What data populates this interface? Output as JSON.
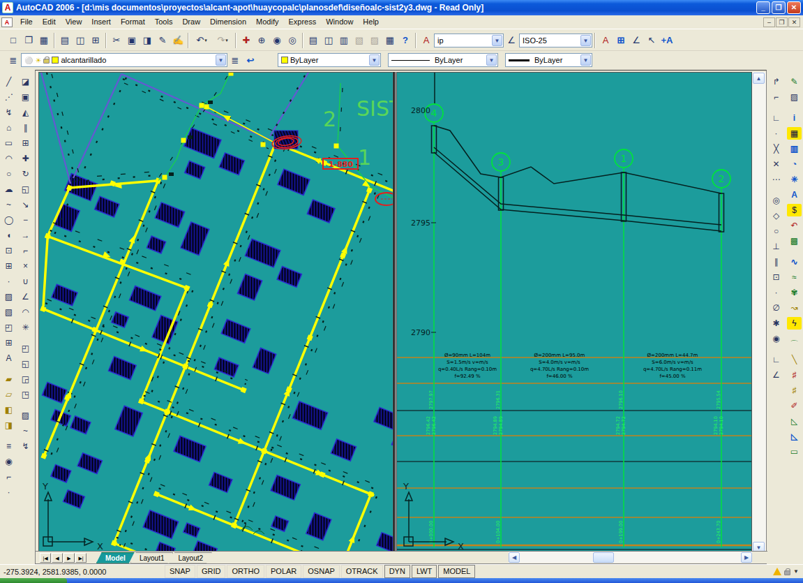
{
  "window": {
    "title": "AutoCAD 2006 - [d:\\mis documentos\\proyectos\\alcant-apot\\huaycopalc\\planosdef\\diseñoalc-sist2y3.dwg - Read Only]",
    "minimize": "_",
    "restore": "❐",
    "close": "✕"
  },
  "menu": {
    "items": [
      "File",
      "Edit",
      "View",
      "Insert",
      "Format",
      "Tools",
      "Draw",
      "Dimension",
      "Modify",
      "Express",
      "Window",
      "Help"
    ]
  },
  "toolbars": {
    "standard": [
      {
        "n": "new",
        "g": "□"
      },
      {
        "n": "open",
        "g": "❐"
      },
      {
        "n": "save",
        "g": "▦"
      },
      {
        "c": "sep"
      },
      {
        "n": "plot",
        "g": "▤"
      },
      {
        "n": "plot-preview",
        "g": "◫"
      },
      {
        "n": "publish",
        "g": "⊞"
      },
      {
        "c": "sep"
      },
      {
        "n": "cut",
        "g": "✂"
      },
      {
        "n": "copy",
        "g": "▣"
      },
      {
        "n": "paste",
        "g": "◨"
      },
      {
        "n": "match-properties",
        "g": "✎"
      },
      {
        "n": "block-editor",
        "g": "✍"
      },
      {
        "c": "sep"
      },
      {
        "n": "undo",
        "g": "↶",
        "c": "dd"
      },
      {
        "n": "redo",
        "g": "↷",
        "c": "dd dis"
      },
      {
        "c": "sep"
      },
      {
        "n": "pan",
        "g": "✚",
        "c": "rr"
      },
      {
        "n": "zoom-realtime",
        "g": "⊕"
      },
      {
        "n": "zoom-window",
        "g": "◉"
      },
      {
        "n": "zoom-previous",
        "g": "◎"
      },
      {
        "c": "sep"
      },
      {
        "n": "properties",
        "g": "▤"
      },
      {
        "n": "designcenter",
        "g": "◫"
      },
      {
        "n": "tool-palettes",
        "g": "▥"
      },
      {
        "n": "sheetset-manager",
        "g": "▧",
        "c": "dis"
      },
      {
        "n": "markup-manager",
        "g": "▨",
        "c": "dis"
      },
      {
        "n": "quickcalc",
        "g": "▦"
      },
      {
        "n": "help",
        "g": "?",
        "c": "bb"
      }
    ],
    "styles": {
      "text_style_icon": "A",
      "text_style_value": "ip",
      "dim_style_value": "ISO-25",
      "extra": [
        {
          "n": "text-style-mgr",
          "g": "A",
          "c": "rr"
        },
        {
          "n": "table-style",
          "g": "⊞",
          "c": "bb"
        },
        {
          "n": "dim-style-mgr",
          "g": "∠"
        },
        {
          "n": "point-style",
          "g": "↖",
          "c": "gg"
        },
        {
          "n": "annotation-style",
          "g": "+A",
          "c": "bb"
        }
      ]
    },
    "layers": {
      "value": "alcantarillado",
      "color_value": "ByLayer",
      "linetype_value": "ByLayer",
      "lineweight_value": "ByLayer"
    },
    "draw": [
      {
        "n": "line",
        "g": "╱"
      },
      {
        "n": "construction-line",
        "g": "⋰"
      },
      {
        "n": "polyline",
        "g": "↯"
      },
      {
        "n": "polygon",
        "g": "⌂"
      },
      {
        "n": "rectangle",
        "g": "▭"
      },
      {
        "n": "arc",
        "g": "◠"
      },
      {
        "n": "circle",
        "g": "○"
      },
      {
        "n": "revcloud",
        "g": "☁"
      },
      {
        "n": "spline",
        "g": "~"
      },
      {
        "n": "ellipse",
        "g": "◯"
      },
      {
        "n": "ellipse-arc",
        "g": "◖"
      },
      {
        "n": "insert-block",
        "g": "⊡"
      },
      {
        "n": "make-block",
        "g": "⊞"
      },
      {
        "n": "point",
        "g": "·"
      },
      {
        "n": "hatch",
        "g": "▨"
      },
      {
        "n": "gradient",
        "g": "▧"
      },
      {
        "n": "region",
        "g": "◰"
      },
      {
        "n": "table",
        "g": "⊞"
      },
      {
        "n": "mtext",
        "g": "A"
      },
      {
        "c": "gap"
      },
      {
        "n": "express-a",
        "g": "▰",
        "c": "yy"
      },
      {
        "n": "express-b",
        "g": "▱",
        "c": "yy"
      },
      {
        "n": "express-c",
        "g": "◧",
        "c": "yy"
      },
      {
        "n": "express-d",
        "g": "◨",
        "c": "yy"
      },
      {
        "c": "gap"
      },
      {
        "n": "list",
        "g": "≡"
      },
      {
        "n": "locate",
        "g": "◉"
      },
      {
        "n": "distance",
        "g": "⌐"
      },
      {
        "n": "id-point",
        "g": "·"
      }
    ],
    "modify": [
      {
        "n": "erase",
        "g": "◪"
      },
      {
        "n": "copy-object",
        "g": "▣"
      },
      {
        "n": "mirror",
        "g": "◭"
      },
      {
        "n": "offset",
        "g": "∥"
      },
      {
        "n": "array",
        "g": "⊞"
      },
      {
        "n": "move",
        "g": "✚"
      },
      {
        "n": "rotate",
        "g": "↻"
      },
      {
        "n": "scale",
        "g": "◱"
      },
      {
        "n": "stretch",
        "g": "↘"
      },
      {
        "n": "trim",
        "g": "−"
      },
      {
        "n": "extend",
        "g": "→"
      },
      {
        "n": "break-point",
        "g": "⌐"
      },
      {
        "n": "break",
        "g": "×"
      },
      {
        "n": "join",
        "g": "∪"
      },
      {
        "n": "chamfer",
        "g": "∠"
      },
      {
        "n": "fillet",
        "g": "◠"
      },
      {
        "n": "explode",
        "g": "✳"
      },
      {
        "c": "gap"
      },
      {
        "n": "draworder-front",
        "g": "◰"
      },
      {
        "n": "draworder-back",
        "g": "◱"
      },
      {
        "n": "draworder-above",
        "g": "◲"
      },
      {
        "n": "draworder-under",
        "g": "◳"
      },
      {
        "c": "gap"
      },
      {
        "n": "edit-hatch",
        "g": "▨"
      },
      {
        "n": "edit-spline",
        "g": "~"
      },
      {
        "n": "edit-pline",
        "g": "↯"
      }
    ],
    "osnap": [
      {
        "n": "temp-track",
        "g": "↱"
      },
      {
        "n": "snap-from",
        "g": "⌐"
      },
      {
        "c": "gap"
      },
      {
        "n": "endpoint",
        "g": "∟"
      },
      {
        "n": "midpoint",
        "g": "∙"
      },
      {
        "n": "intersection",
        "g": "╳"
      },
      {
        "n": "apparent-int",
        "g": "✕"
      },
      {
        "n": "extension",
        "g": "⋯"
      },
      {
        "c": "gap"
      },
      {
        "n": "center",
        "g": "◎"
      },
      {
        "n": "quadrant",
        "g": "◇"
      },
      {
        "n": "tangent",
        "g": "○"
      },
      {
        "n": "perpendicular",
        "g": "⊥"
      },
      {
        "n": "parallel",
        "g": "∥"
      },
      {
        "n": "insert",
        "g": "⊡"
      },
      {
        "n": "node",
        "g": "·"
      },
      {
        "n": "nearest",
        "g": "∅"
      },
      {
        "n": "none",
        "g": "✱"
      },
      {
        "n": "osnap-settings",
        "g": "◉"
      },
      {
        "c": "gap"
      },
      {
        "n": "ortho-mode",
        "g": "∟"
      },
      {
        "n": "polar-mode",
        "g": "∠"
      }
    ],
    "tools2": [
      {
        "n": "sketch",
        "g": "✎",
        "c": "gg"
      },
      {
        "n": "render",
        "g": "▨"
      },
      {
        "c": "gap"
      },
      {
        "n": "info",
        "g": "i",
        "c": "bb"
      },
      {
        "n": "lock",
        "g": "▦",
        "c": "ybg"
      },
      {
        "n": "table2",
        "g": "▥",
        "c": "bb"
      },
      {
        "n": "clock",
        "g": "◔",
        "c": "bb"
      },
      {
        "n": "zoomx",
        "g": "✳",
        "c": "bb"
      },
      {
        "n": "textA",
        "g": "A",
        "c": "bb"
      },
      {
        "n": "dollar",
        "g": "$",
        "c": "ybg"
      },
      {
        "n": "redoarr",
        "g": "↶",
        "c": "rr"
      },
      {
        "n": "image",
        "g": "▩",
        "c": "gg"
      },
      {
        "c": "gap"
      },
      {
        "n": "pipe",
        "g": "∿",
        "c": "bb"
      },
      {
        "n": "water",
        "g": "≈",
        "c": "gg"
      },
      {
        "n": "plant",
        "g": "✾",
        "c": "gg"
      },
      {
        "n": "arrowy",
        "g": "↝",
        "c": "yy"
      },
      {
        "n": "bolt",
        "g": "ϟ",
        "c": "ybg"
      },
      {
        "c": "gap"
      },
      {
        "n": "tube",
        "g": "⌒",
        "c": "gg"
      },
      {
        "n": "brk",
        "g": "╲",
        "c": "yy"
      },
      {
        "n": "fence1",
        "g": "♯",
        "c": "rr"
      },
      {
        "n": "fence2",
        "g": "♯",
        "c": "yy"
      },
      {
        "n": "pen2",
        "g": "✐",
        "c": "rr"
      },
      {
        "n": "chart",
        "g": "◺",
        "c": "gg"
      },
      {
        "n": "grade",
        "g": "◺",
        "c": "bb"
      },
      {
        "n": "layout-tool",
        "g": "▭",
        "c": "gg"
      }
    ]
  },
  "tabs": {
    "nav": [
      {
        "t": "|◀"
      },
      {
        "t": "◀"
      },
      {
        "t": "▶"
      },
      {
        "t": "▶|"
      }
    ],
    "items": [
      {
        "t": "Model",
        "c": "active"
      },
      {
        "t": "Layout1"
      },
      {
        "t": "Layout2"
      }
    ]
  },
  "status": {
    "coords": "-275.3924, 2581.9385, 0.0000",
    "toggles": [
      {
        "t": "SNAP"
      },
      {
        "t": "GRID"
      },
      {
        "t": "ORTHO"
      },
      {
        "t": "POLAR"
      },
      {
        "t": "OSNAP"
      },
      {
        "t": "OTRACK"
      },
      {
        "t": "DYN",
        "c": "on"
      },
      {
        "t": "LWT",
        "c": "on"
      },
      {
        "t": "MODEL",
        "c": "on"
      }
    ]
  },
  "plan": {
    "sist": "SIST",
    "num2": "2",
    "num1": "1",
    "red_label": "1-880",
    "axis_x": "X",
    "axis_y": "Y"
  },
  "profile": {
    "elevations": [
      {
        "label": "2800"
      },
      {
        "label": "2795"
      },
      {
        "label": "2790"
      }
    ],
    "stations": [
      {
        "label": "4"
      },
      {
        "label": "3"
      },
      {
        "label": "1"
      },
      {
        "label": "2"
      }
    ],
    "annotations": [
      [
        "Ø=90mm  L=104m",
        "S=1.5m/s  v=m/s",
        "q=0.40L/s  Rang=0.10m",
        "f=92.49 %"
      ],
      [
        "Ø=200mm  L=95.0m",
        "S=4.0m/s  v=m/s",
        "q=4.70L/s  Rang=0.10m",
        "f=46.00 %"
      ],
      [
        "Ø=200mm  L=44.7m",
        "S=6.0m/s  v=m/s",
        "q=4.70L/s  Rang=0.11m",
        "f=45.00 %"
      ]
    ],
    "vtop": [
      "2797.97",
      "2796.31",
      "2796.10",
      "2795.54"
    ],
    "vmid": [
      "2796.42",
      "2794.89",
      "2794.72",
      "2794.10"
    ],
    "vbot": [
      "0+000.00",
      "0+104.00",
      "0+199.00",
      "0+243.70"
    ],
    "axis_x": "X",
    "axis_y": "Y"
  }
}
